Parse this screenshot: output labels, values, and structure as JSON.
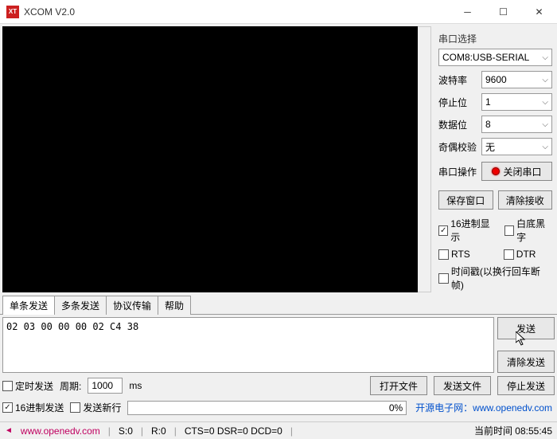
{
  "window": {
    "title": "XCOM V2.0"
  },
  "sidebar": {
    "section_label": "串口选择",
    "port": "COM8:USB-SERIAL",
    "baud": {
      "label": "波特率",
      "value": "9600"
    },
    "stop": {
      "label": "停止位",
      "value": "1"
    },
    "data": {
      "label": "数据位",
      "value": "8"
    },
    "parity": {
      "label": "奇偶校验",
      "value": "无"
    },
    "operation": {
      "label": "串口操作",
      "button": "关闭串口"
    },
    "save_window": "保存窗口",
    "clear_recv": "清除接收",
    "hex_display": "16进制显示",
    "white_bg": "白底黑字",
    "rts": "RTS",
    "dtr": "DTR",
    "timestamp": "时间戳(以换行回车断帧)"
  },
  "tabs": {
    "single": "单条发送",
    "multi": "多条发送",
    "protocol": "协议传输",
    "help": "帮助"
  },
  "send": {
    "text": "02 03 00 00 00 02 C4 38",
    "send_btn": "发送",
    "clear_btn": "清除发送"
  },
  "options": {
    "timed_send": "定时发送",
    "period_label": "周期:",
    "period_value": "1000",
    "period_unit": "ms",
    "open_file": "打开文件",
    "send_file": "发送文件",
    "stop_send": "停止发送",
    "hex_send": "16进制发送",
    "send_newline": "发送新行",
    "progress": "0%",
    "link_label": "开源电子网：",
    "link_url": "www.openedv.com"
  },
  "status": {
    "url": "www.openedv.com",
    "s": "S:0",
    "r": "R:0",
    "signals": "CTS=0 DSR=0 DCD=0",
    "time_label": "当前时间 08:55:45"
  }
}
